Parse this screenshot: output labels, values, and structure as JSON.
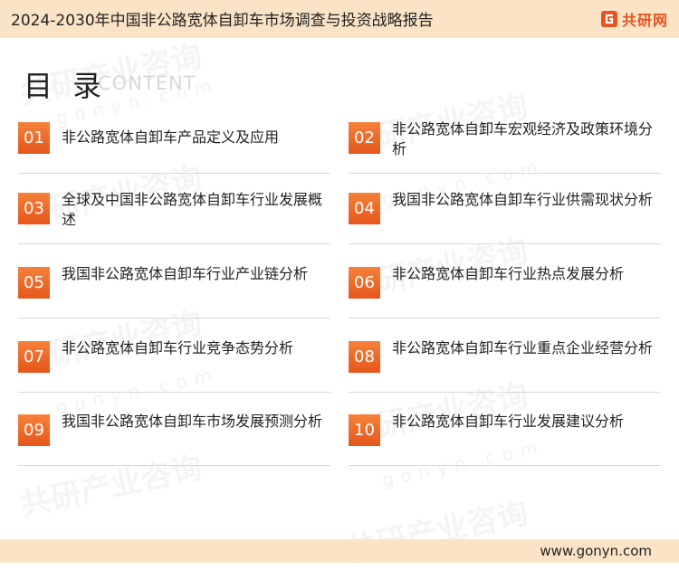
{
  "header": {
    "title": "2024-2030年中国非公路宽体自卸车市场调查与投资战略报告",
    "brand": "共研网"
  },
  "heading": {
    "title": "目 录",
    "subtitle": "CONTENT"
  },
  "toc": [
    {
      "num": "01",
      "text": "非公路宽体自卸车产品定义及应用"
    },
    {
      "num": "02",
      "text": "非公路宽体自卸车宏观经济及政策环境分析"
    },
    {
      "num": "03",
      "text": "全球及中国非公路宽体自卸车行业发展概述"
    },
    {
      "num": "04",
      "text": "我国非公路宽体自卸车行业供需现状分析"
    },
    {
      "num": "05",
      "text": "我国非公路宽体自卸车行业产业链分析"
    },
    {
      "num": "06",
      "text": "非公路宽体自卸车行业热点发展分析"
    },
    {
      "num": "07",
      "text": "非公路宽体自卸车行业竞争态势分析"
    },
    {
      "num": "08",
      "text": "非公路宽体自卸车行业重点企业经营分析"
    },
    {
      "num": "09",
      "text": "我国非公路宽体自卸车市场发展预测分析"
    },
    {
      "num": "10",
      "text": "非公路宽体自卸车行业发展建议分析"
    }
  ],
  "footer": {
    "url": "www.gonyn.com"
  },
  "colors": {
    "accent": "#e8541e",
    "band": "#fbe3c6"
  },
  "icons": {
    "brand": "gonyn-logo-icon"
  }
}
